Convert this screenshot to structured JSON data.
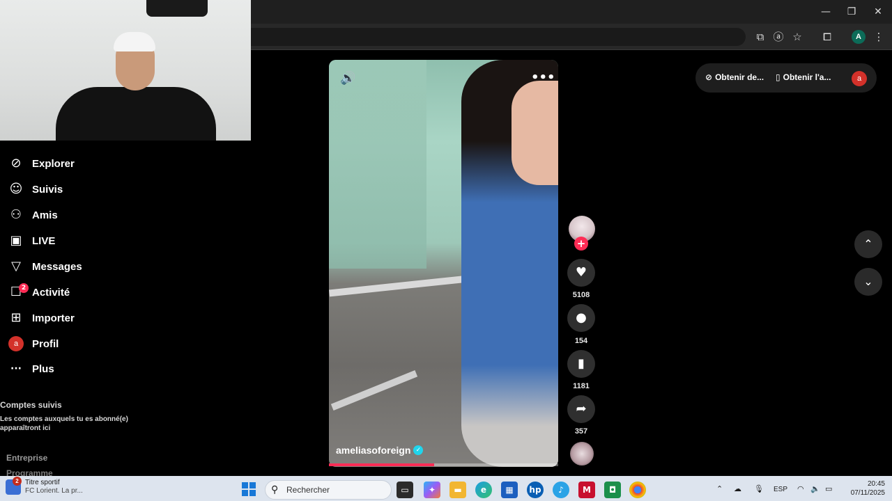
{
  "browser": {
    "window_controls": {
      "minimize": "—",
      "restore": "❐",
      "close": "✕"
    },
    "toolbar_icons": [
      "cast-icon",
      "translate-icon",
      "star-icon",
      "extensions-icon",
      "more-vertical-icon"
    ],
    "profile_initial": "A"
  },
  "sidebar": {
    "items": [
      {
        "label": "Explorer",
        "icon": "compass-icon",
        "glyph": "⊘"
      },
      {
        "label": "Suivis",
        "icon": "following-icon",
        "glyph": "☺"
      },
      {
        "label": "Amis",
        "icon": "friends-icon",
        "glyph": "⚇"
      },
      {
        "label": "LIVE",
        "icon": "live-icon",
        "glyph": "▣"
      },
      {
        "label": "Messages",
        "icon": "messages-icon",
        "glyph": "▽"
      },
      {
        "label": "Activité",
        "icon": "activity-icon",
        "glyph": "☐",
        "badge": "2"
      },
      {
        "label": "Importer",
        "icon": "upload-icon",
        "glyph": "⊞"
      },
      {
        "label": "Profil",
        "icon": "profile-icon",
        "glyph": "a"
      },
      {
        "label": "Plus",
        "icon": "more-icon",
        "glyph": "···"
      }
    ],
    "followed_title": "Comptes suivis",
    "followed_desc": "Les comptes auxquels tu es abonné(e) apparaîtront ici",
    "footer": {
      "entreprise": "Entreprise",
      "programme": "Programme"
    }
  },
  "video": {
    "author": "ameliasoforeign",
    "verified": "✓",
    "mute_glyph": "🔊",
    "more_glyph": "•••",
    "progress": 0.46
  },
  "actions": {
    "follow": "+",
    "like": {
      "glyph": "♥",
      "count": "5108"
    },
    "comment": {
      "glyph": "●",
      "count": "154"
    },
    "save": {
      "glyph": "▮",
      "count": "1181"
    },
    "share": {
      "glyph": "➦",
      "count": "357"
    }
  },
  "top_pill": {
    "coins": {
      "icon": "⊘",
      "label": "Obtenir de..."
    },
    "app": {
      "icon": "▯",
      "label": "Obtenir l'a..."
    },
    "avatar": "a"
  },
  "nav_arrows": {
    "up": "⌃",
    "down": "⌄"
  },
  "taskbar": {
    "news_badge": "2",
    "news_title": "Titre sportif",
    "news_sub": "FC Lorient. La pr...",
    "search_label": "Rechercher",
    "search_glyph": "⚲",
    "lang": "ESP",
    "time": "20:45",
    "date": "07/11/2025"
  },
  "colors": {
    "accent": "#fe2c55",
    "verified": "#20d5ec",
    "profile_red": "#d3312a"
  }
}
